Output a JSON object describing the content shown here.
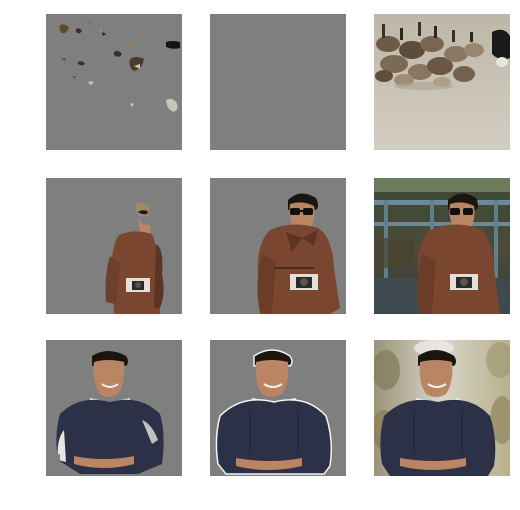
{
  "figure": {
    "rows": [
      {
        "name": "geese",
        "cells": [
          "segmentation-partial",
          "segmentation-empty",
          "original-photo"
        ]
      },
      {
        "name": "man-sunglasses",
        "cells": [
          "segmentation-partial",
          "segmentation-full",
          "original-photo"
        ]
      },
      {
        "name": "man-sweater",
        "cells": [
          "segmentation-partial",
          "segmentation-full",
          "original-photo"
        ]
      }
    ]
  },
  "colors": {
    "mask_gray": "#7f7f7f",
    "jacket_brown": "#7a4630",
    "sweater_navy": "#2c3148",
    "skin": "#b98562",
    "hair": "#1b1510",
    "ground_beige": "#c8c2b4"
  }
}
